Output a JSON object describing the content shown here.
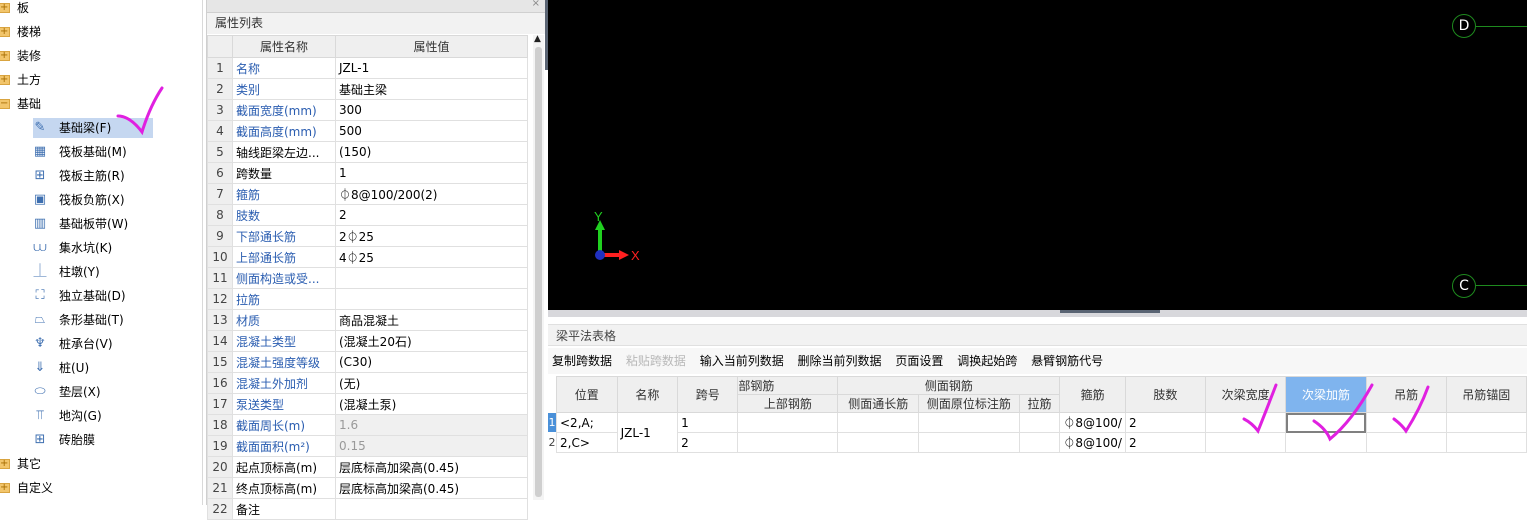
{
  "tree": {
    "top_folders": [
      {
        "label": "板",
        "expanded": false
      },
      {
        "label": "楼梯",
        "expanded": false
      },
      {
        "label": "装修",
        "expanded": false
      },
      {
        "label": "土方",
        "expanded": false
      },
      {
        "label": "基础",
        "expanded": true
      }
    ],
    "children": [
      {
        "label": "基础梁(F)",
        "icon": "pencil-icon",
        "glyph": "✎",
        "selected": true
      },
      {
        "label": "筏板基础(M)",
        "icon": "raft-foundation-icon",
        "glyph": "▦"
      },
      {
        "label": "筏板主筋(R)",
        "icon": "raft-main-rebar-icon",
        "glyph": "⊞"
      },
      {
        "label": "筏板负筋(X)",
        "icon": "raft-negative-rebar-icon",
        "glyph": "▣"
      },
      {
        "label": "基础板带(W)",
        "icon": "foundation-strip-icon",
        "glyph": "▥"
      },
      {
        "label": "集水坑(K)",
        "icon": "sump-pit-icon",
        "glyph": "⩊"
      },
      {
        "label": "柱墩(Y)",
        "icon": "column-pier-icon",
        "glyph": "⏊"
      },
      {
        "label": "独立基础(D)",
        "icon": "isolated-footing-icon",
        "glyph": "⛶"
      },
      {
        "label": "条形基础(T)",
        "icon": "strip-footing-icon",
        "glyph": "⏢"
      },
      {
        "label": "桩承台(V)",
        "icon": "pile-cap-icon",
        "glyph": "♆"
      },
      {
        "label": "桩(U)",
        "icon": "pile-icon",
        "glyph": "⇓"
      },
      {
        "label": "垫层(X)",
        "icon": "cushion-icon",
        "glyph": "⬭"
      },
      {
        "label": "地沟(G)",
        "icon": "trench-icon",
        "glyph": "⫪"
      },
      {
        "label": "砖胎膜",
        "icon": "brick-mold-icon",
        "glyph": "⊞"
      }
    ],
    "bottom_folders": [
      {
        "label": "其它",
        "expanded": false
      },
      {
        "label": "自定义",
        "expanded": false
      }
    ]
  },
  "properties": {
    "title": "属性列表",
    "col_name": "属性名称",
    "col_value": "属性值",
    "rows": [
      {
        "n": "1",
        "name": "名称",
        "value": "JZL-1",
        "blue": true
      },
      {
        "n": "2",
        "name": "类别",
        "value": "基础主梁",
        "blue": true
      },
      {
        "n": "3",
        "name": "截面宽度(mm)",
        "value": "300",
        "blue": true
      },
      {
        "n": "4",
        "name": "截面高度(mm)",
        "value": "500",
        "blue": true
      },
      {
        "n": "5",
        "name": "轴线距梁左边...",
        "value": "(150)",
        "blue": false
      },
      {
        "n": "6",
        "name": "跨数量",
        "value": "1",
        "blue": false
      },
      {
        "n": "7",
        "name": "箍筋",
        "value": "⏀8@100/200(2)",
        "blue": true
      },
      {
        "n": "8",
        "name": "肢数",
        "value": "2",
        "blue": true
      },
      {
        "n": "9",
        "name": "下部通长筋",
        "value": "2⏀25",
        "blue": true
      },
      {
        "n": "10",
        "name": "上部通长筋",
        "value": "4⏀25",
        "blue": true
      },
      {
        "n": "11",
        "name": "侧面构造或受...",
        "value": "",
        "blue": true
      },
      {
        "n": "12",
        "name": "拉筋",
        "value": "",
        "blue": true
      },
      {
        "n": "13",
        "name": "材质",
        "value": "商品混凝土",
        "blue": true
      },
      {
        "n": "14",
        "name": "混凝土类型",
        "value": "(混凝土20石)",
        "blue": true
      },
      {
        "n": "15",
        "name": "混凝土强度等级",
        "value": "(C30)",
        "blue": true
      },
      {
        "n": "16",
        "name": "混凝土外加剂",
        "value": "(无)",
        "blue": true
      },
      {
        "n": "17",
        "name": "泵送类型",
        "value": "(混凝土泵)",
        "blue": true
      },
      {
        "n": "18",
        "name": "截面周长(m)",
        "value": "1.6",
        "blue": true,
        "readonly": true
      },
      {
        "n": "19",
        "name": "截面面积(m²)",
        "value": "0.15",
        "blue": true,
        "readonly": true
      },
      {
        "n": "20",
        "name": "起点顶标高(m)",
        "value": "层底标高加梁高(0.45)",
        "blue": false
      },
      {
        "n": "21",
        "name": "终点顶标高(m)",
        "value": "层底标高加梁高(0.45)",
        "blue": false
      },
      {
        "n": "22",
        "name": "备注",
        "value": "",
        "blue": false
      }
    ]
  },
  "viewport": {
    "axis_labels": [
      "D",
      "C"
    ],
    "ucs": {
      "x": "X",
      "y": "Y"
    },
    "colors": {
      "background": "#000000",
      "axis": "#1e8a1e",
      "x_axis": "#ff2020",
      "y_axis": "#20d020"
    }
  },
  "beam_table": {
    "title": "梁平法表格",
    "toolbar": [
      {
        "label": "复制跨数据",
        "enabled": true
      },
      {
        "label": "粘贴跨数据",
        "enabled": false
      },
      {
        "label": "输入当前列数据",
        "enabled": true
      },
      {
        "label": "删除当前列数据",
        "enabled": true
      },
      {
        "label": "页面设置",
        "enabled": true
      },
      {
        "label": "调换起始跨",
        "enabled": true
      },
      {
        "label": "悬臂钢筋代号",
        "enabled": true
      }
    ],
    "headers": {
      "position": "位置",
      "name": "名称",
      "span": "跨号",
      "top_rebar_group": "部钢筋",
      "top_rebar": "上部钢筋",
      "side_rebar_group": "侧面钢筋",
      "side_long": "侧面通长筋",
      "side_in_situ": "侧面原位标注筋",
      "tie": "拉筋",
      "stirrup": "箍筋",
      "legs": "肢数",
      "secondary_width": "次梁宽度",
      "secondary_add": "次梁加筋",
      "hanger": "吊筋",
      "hanger_anchor": "吊筋锚固"
    },
    "rows": [
      {
        "rownum": "1",
        "position": "<2,A;",
        "name": "JZL-1",
        "span": "1",
        "stirrup": "⏀8@100/",
        "legs": "2"
      },
      {
        "rownum": "2",
        "position": "2,C>",
        "name": "",
        "span": "2",
        "stirrup": "⏀8@100/",
        "legs": "2"
      }
    ],
    "selected_column": "次梁加筋"
  },
  "annotations": {
    "check_mark_color": "#e020e0"
  }
}
